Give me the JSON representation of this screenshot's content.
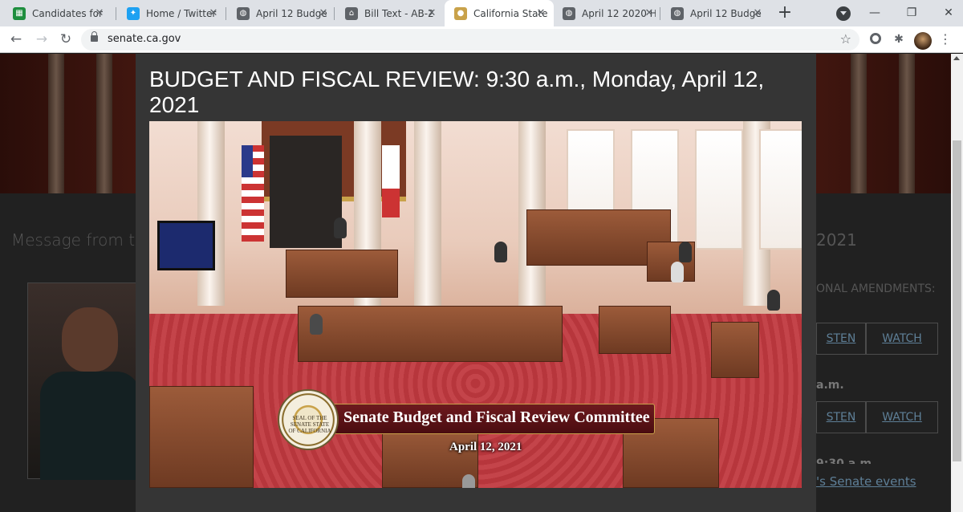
{
  "browser": {
    "tabs": [
      {
        "title": "Candidates for",
        "icon": "sheets-icon",
        "color": "#1e8e3e"
      },
      {
        "title": "Home / Twitter",
        "icon": "twitter-icon",
        "color": "#1da1f2"
      },
      {
        "title": "April 12 Budge",
        "icon": "globe-icon",
        "color": "#5f6368"
      },
      {
        "title": "Bill Text - AB-2",
        "icon": "capitol-icon",
        "color": "#5f6368"
      },
      {
        "title": "California State",
        "icon": "seal-icon",
        "color": "#c9a24a",
        "active": true
      },
      {
        "title": "April 12 2020 H",
        "icon": "globe-icon",
        "color": "#5f6368"
      },
      {
        "title": "April 12 Budge",
        "icon": "globe-icon",
        "color": "#5f6368"
      }
    ],
    "url": "senate.ca.gov"
  },
  "background": {
    "message_heading": "Message from th",
    "year_fragment": "2021",
    "amendments_fragment": "ONAL AMENDMENTS:",
    "listen_1": "STEN",
    "watch_1": "WATCH",
    "time_fragment_1": "a.m.",
    "listen_2": "STEN",
    "watch_2": "WATCH",
    "time_fragment_2": "9:30 a.m.",
    "events_link": "'s Senate events"
  },
  "modal": {
    "title": "BUDGET AND FISCAL REVIEW: 9:30 a.m., Monday, April 12, 2021"
  },
  "video": {
    "banner_title": "Senate Budget and Fiscal Review Committee",
    "banner_date": "April 12, 2021",
    "seal_text": "SEAL OF THE SENATE STATE OF CALIFORNIA"
  }
}
